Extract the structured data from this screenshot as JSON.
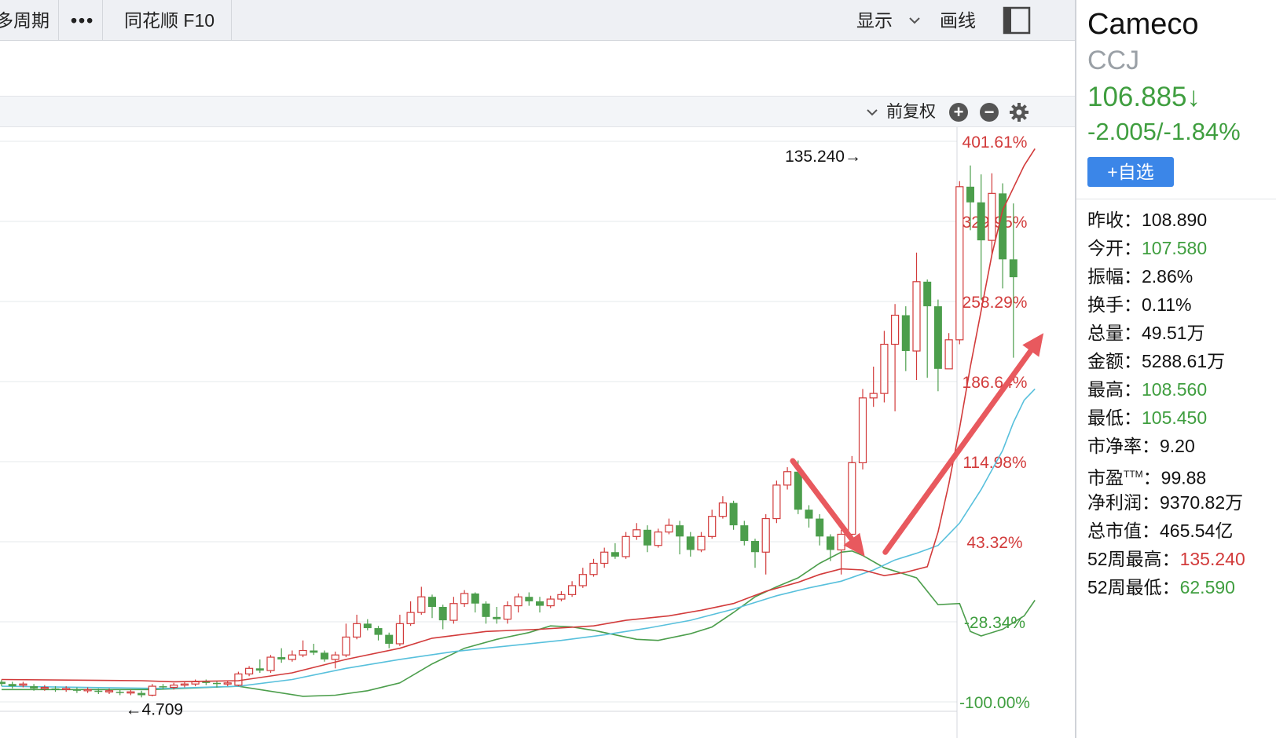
{
  "toolbar": {
    "multi_period": "多周期",
    "more": "•••",
    "f10": "同花顺 F10",
    "display": "显示",
    "draw": "画线"
  },
  "subbar": {
    "adjust": "前复权",
    "zoom_in": "+",
    "zoom_out": "−"
  },
  "stock": {
    "name": "Cameco",
    "code": "CCJ",
    "price": "106.885↓",
    "change": "-2.005/-1.84%",
    "watch_label": "+自选"
  },
  "stats": [
    {
      "label": "昨收：",
      "value": "108.890",
      "color": "black"
    },
    {
      "label": "今开：",
      "value": "107.580",
      "color": "green"
    },
    {
      "label": "振幅：",
      "value": "2.86%",
      "color": "black"
    },
    {
      "label": "换手：",
      "value": "0.11%",
      "color": "black"
    },
    {
      "label": "总量：",
      "value": "49.51万",
      "color": "black"
    },
    {
      "label": "金额：",
      "value": "5288.61万",
      "color": "black"
    },
    {
      "label": "最高：",
      "value": "108.560",
      "color": "green"
    },
    {
      "label": "最低：",
      "value": "105.450",
      "color": "green"
    },
    {
      "label": "市净率：",
      "value": "9.20",
      "color": "black"
    },
    {
      "label": "市盈",
      "sup": "TTM",
      "label_tail": "：",
      "value": "99.88",
      "color": "black"
    },
    {
      "label": "净利润：",
      "value": "9370.82万",
      "color": "black"
    },
    {
      "label": "总市值：",
      "value": "465.54亿",
      "color": "black"
    },
    {
      "label": "52周最高：",
      "value": "135.240",
      "color": "red"
    },
    {
      "label": "52周最低：",
      "value": "62.590",
      "color": "green"
    }
  ],
  "chart_data": {
    "type": "candlestick",
    "y_axis_ticks": [
      "401.61%",
      "329.95%",
      "258.29%",
      "186.64%",
      "114.98%",
      "43.32%",
      "-28.34%",
      "-100.00%"
    ],
    "y_axis_range": [
      -100.0,
      401.61
    ],
    "max_annotation": "135.240→",
    "min_annotation": "←4.709",
    "colors": {
      "up": "#d23b3b",
      "down": "#4c9e4c",
      "ma_red": "#d23b3b",
      "ma_blue": "#58c0dc",
      "ma_green": "#4c9e4c",
      "arrow": "#e8595e",
      "grid": "#e6e8eb",
      "axis_red": "#d23b3b",
      "axis_green": "#3f9e3f"
    },
    "candles": [
      [
        -82,
        -84,
        -80,
        -86,
        0
      ],
      [
        -84,
        -86,
        -82,
        -88,
        0
      ],
      [
        -85,
        -84,
        -82,
        -87,
        1
      ],
      [
        -86,
        -88,
        -84,
        -90,
        0
      ],
      [
        -88,
        -87,
        -85,
        -90,
        1
      ],
      [
        -88,
        -89,
        -86,
        -91,
        0
      ],
      [
        -89,
        -88,
        -86,
        -91,
        1
      ],
      [
        -89,
        -90,
        -87,
        -92,
        0
      ],
      [
        -90,
        -89,
        -87,
        -92,
        1
      ],
      [
        -90,
        -91,
        -88,
        -93,
        0
      ],
      [
        -91,
        -90,
        -88,
        -93,
        1
      ],
      [
        -91,
        -92,
        -89,
        -94,
        0
      ],
      [
        -92,
        -91,
        -89,
        -94,
        1
      ],
      [
        -92,
        -94,
        -90,
        -96,
        0
      ],
      [
        -94,
        -86,
        -84,
        -95,
        1
      ],
      [
        -86,
        -87,
        -84,
        -89,
        0
      ],
      [
        -87,
        -85,
        -83,
        -89,
        1
      ],
      [
        -85,
        -84,
        -82,
        -87,
        1
      ],
      [
        -84,
        -82,
        -80,
        -86,
        1
      ],
      [
        -82,
        -83,
        -80,
        -85,
        0
      ],
      [
        -83,
        -84,
        -81,
        -87,
        0
      ],
      [
        -84,
        -83,
        -81,
        -86,
        1
      ],
      [
        -85,
        -75,
        -73,
        -86,
        1
      ],
      [
        -75,
        -70,
        -68,
        -77,
        1
      ],
      [
        -70,
        -72,
        -62,
        -74,
        0
      ],
      [
        -72,
        -60,
        -58,
        -74,
        1
      ],
      [
        -60,
        -62,
        -52,
        -65,
        0
      ],
      [
        -62,
        -58,
        -54,
        -64,
        1
      ],
      [
        -58,
        -54,
        -45,
        -60,
        1
      ],
      [
        -54,
        -56,
        -48,
        -58,
        0
      ],
      [
        -56,
        -62,
        -54,
        -64,
        0
      ],
      [
        -62,
        -58,
        -55,
        -70,
        1
      ],
      [
        -58,
        -42,
        -30,
        -60,
        1
      ],
      [
        -42,
        -30,
        -22,
        -44,
        1
      ],
      [
        -30,
        -34,
        -26,
        -36,
        0
      ],
      [
        -34,
        -40,
        -32,
        -45,
        0
      ],
      [
        -40,
        -48,
        -38,
        -52,
        0
      ],
      [
        -48,
        -30,
        -22,
        -50,
        1
      ],
      [
        -30,
        -20,
        -10,
        -32,
        1
      ],
      [
        -20,
        -6,
        3,
        -22,
        1
      ],
      [
        -6,
        -15,
        -4,
        -25,
        0
      ],
      [
        -15,
        -27,
        -13,
        -35,
        0
      ],
      [
        -27,
        -12,
        -6,
        -30,
        1
      ],
      [
        -12,
        -3,
        0,
        -15,
        1
      ],
      [
        -3,
        -12,
        -2,
        -20,
        0
      ],
      [
        -12,
        -24,
        -10,
        -30,
        0
      ],
      [
        -24,
        -26,
        -15,
        -30,
        0
      ],
      [
        -26,
        -14,
        -10,
        -30,
        1
      ],
      [
        -14,
        -6,
        -3,
        -20,
        1
      ],
      [
        -6,
        -10,
        -2,
        -14,
        0
      ],
      [
        -10,
        -14,
        -6,
        -20,
        0
      ],
      [
        -14,
        -8,
        -5,
        -16,
        1
      ],
      [
        -8,
        -4,
        -1,
        -10,
        1
      ],
      [
        -4,
        4,
        8,
        -6,
        1
      ],
      [
        4,
        14,
        20,
        2,
        1
      ],
      [
        14,
        24,
        28,
        12,
        1
      ],
      [
        24,
        34,
        38,
        20,
        1
      ],
      [
        34,
        30,
        42,
        28,
        0
      ],
      [
        30,
        48,
        52,
        28,
        1
      ],
      [
        48,
        54,
        60,
        45,
        1
      ],
      [
        54,
        40,
        58,
        34,
        0
      ],
      [
        40,
        52,
        55,
        38,
        1
      ],
      [
        52,
        58,
        64,
        50,
        1
      ],
      [
        58,
        48,
        62,
        32,
        0
      ],
      [
        48,
        36,
        52,
        30,
        0
      ],
      [
        36,
        48,
        52,
        34,
        1
      ],
      [
        48,
        66,
        72,
        46,
        1
      ],
      [
        66,
        78,
        84,
        64,
        1
      ],
      [
        78,
        58,
        80,
        54,
        0
      ],
      [
        58,
        44,
        62,
        40,
        0
      ],
      [
        44,
        34,
        46,
        20,
        0
      ],
      [
        34,
        64,
        68,
        14,
        1
      ],
      [
        64,
        94,
        98,
        60,
        1
      ],
      [
        94,
        106,
        110,
        90,
        1
      ],
      [
        106,
        72,
        116,
        68,
        0
      ],
      [
        72,
        64,
        76,
        56,
        0
      ],
      [
        64,
        48,
        68,
        40,
        0
      ],
      [
        48,
        36,
        50,
        26,
        0
      ],
      [
        36,
        50,
        54,
        14,
        1
      ],
      [
        50,
        114,
        120,
        44,
        1
      ],
      [
        114,
        172,
        180,
        108,
        1
      ],
      [
        172,
        176,
        200,
        164,
        1
      ],
      [
        176,
        220,
        232,
        168,
        1
      ],
      [
        220,
        246,
        256,
        160,
        1
      ],
      [
        246,
        214,
        254,
        196,
        0
      ],
      [
        214,
        276,
        302,
        188,
        1
      ],
      [
        276,
        254,
        278,
        190,
        0
      ],
      [
        254,
        198,
        260,
        178,
        0
      ],
      [
        198,
        224,
        230,
        214,
        1
      ],
      [
        224,
        361,
        366,
        220,
        1
      ],
      [
        361,
        347,
        380,
        322,
        0
      ],
      [
        347,
        313,
        372,
        260,
        0
      ],
      [
        313,
        355,
        373,
        300,
        1
      ],
      [
        355,
        296,
        364,
        270,
        0
      ],
      [
        296,
        280,
        346,
        208,
        0
      ]
    ],
    "ma_red": [
      [
        0,
        -80
      ],
      [
        13,
        -81
      ],
      [
        16,
        -82
      ],
      [
        22,
        -81
      ],
      [
        27,
        -74
      ],
      [
        32,
        -62
      ],
      [
        37,
        -52
      ],
      [
        40,
        -43
      ],
      [
        45,
        -37
      ],
      [
        50,
        -35
      ],
      [
        55,
        -32
      ],
      [
        58,
        -27
      ],
      [
        62,
        -23
      ],
      [
        65,
        -18
      ],
      [
        68,
        -12
      ],
      [
        71,
        -1
      ],
      [
        74,
        7
      ],
      [
        76,
        14
      ],
      [
        78,
        19
      ],
      [
        80,
        18
      ],
      [
        82,
        13
      ],
      [
        84,
        16
      ],
      [
        86,
        21
      ],
      [
        87,
        52
      ],
      [
        88,
        95
      ],
      [
        89,
        145
      ],
      [
        90,
        200
      ],
      [
        91,
        250
      ],
      [
        92,
        300
      ],
      [
        93,
        340
      ],
      [
        94,
        360
      ],
      [
        95,
        380
      ],
      [
        96,
        395
      ]
    ],
    "ma_blue": [
      [
        0,
        -86
      ],
      [
        15,
        -88
      ],
      [
        22,
        -86
      ],
      [
        27,
        -80
      ],
      [
        32,
        -70
      ],
      [
        37,
        -62
      ],
      [
        42,
        -55
      ],
      [
        47,
        -50
      ],
      [
        52,
        -45
      ],
      [
        56,
        -40
      ],
      [
        60,
        -34
      ],
      [
        64,
        -27
      ],
      [
        68,
        -17
      ],
      [
        72,
        -5
      ],
      [
        75,
        2
      ],
      [
        78,
        8
      ],
      [
        81,
        18
      ],
      [
        83,
        27
      ],
      [
        85,
        33
      ],
      [
        87,
        40
      ],
      [
        89,
        60
      ],
      [
        91,
        90
      ],
      [
        93,
        125
      ],
      [
        94,
        150
      ],
      [
        95,
        170
      ],
      [
        96,
        180
      ]
    ],
    "ma_green": [
      [
        0,
        -89
      ],
      [
        14,
        -89
      ],
      [
        22,
        -86
      ],
      [
        28,
        -95
      ],
      [
        31,
        -94
      ],
      [
        34,
        -90
      ],
      [
        37,
        -83
      ],
      [
        40,
        -66
      ],
      [
        43,
        -52
      ],
      [
        46,
        -44
      ],
      [
        49,
        -38
      ],
      [
        51,
        -32
      ],
      [
        53,
        -33
      ],
      [
        55,
        -36
      ],
      [
        59,
        -44
      ],
      [
        61,
        -45
      ],
      [
        64,
        -39
      ],
      [
        66,
        -33
      ],
      [
        68,
        -20
      ],
      [
        70,
        -6
      ],
      [
        72,
        3
      ],
      [
        74,
        11
      ],
      [
        76,
        24
      ],
      [
        78,
        34
      ],
      [
        79,
        35
      ],
      [
        80,
        31
      ],
      [
        82,
        20
      ],
      [
        85,
        11
      ],
      [
        87,
        -13
      ],
      [
        89,
        -12
      ],
      [
        90,
        -37
      ],
      [
        91,
        -41
      ],
      [
        93,
        -35
      ],
      [
        95,
        -23
      ],
      [
        96,
        -9
      ]
    ],
    "arrows": [
      {
        "from": [
          73.5,
          115.7
        ],
        "to": [
          80.2,
          30
        ]
      },
      {
        "from": [
          82.1,
          34
        ],
        "to": [
          96.8,
          230
        ]
      }
    ]
  }
}
